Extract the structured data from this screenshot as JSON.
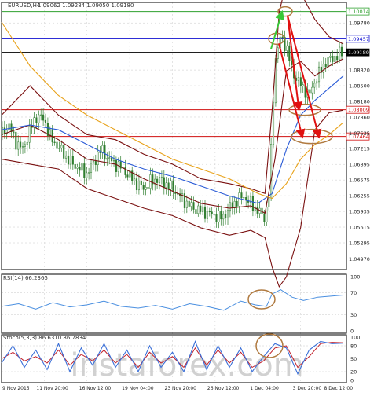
{
  "header": {
    "symbol": "EURUSD,H4",
    "ohlc": "1.09062 1.09284 1.09050 1.09180"
  },
  "indicators": {
    "rsi_label": "RSI(14) 66.2365",
    "stoch_label": "Stoch(5,3,3) 86.6310 86.7834"
  },
  "watermark": "instaforex.com",
  "colors": {
    "background": "#ffffff",
    "grid": "#c8c8c8",
    "candles": "#2e7d2e",
    "bollinger": "#7a1010",
    "ma_fast": "#7a1010",
    "ma_mid": "#2a5bd7",
    "ma_slow": "#e8a21a",
    "rsi_line": "#4a8fe0",
    "stoch_main": "#3a6fd8",
    "stoch_signal": "#c0202a",
    "level_blue": "#1010d0",
    "level_red": "#d01010",
    "level_green": "#2ea02e",
    "arrow_red": "#e01010",
    "arrow_green": "#37c837",
    "ellipse": "#b07a40"
  },
  "chart_data": [
    {
      "type": "line",
      "title": "EURUSD,H4",
      "y_ticks": [
        "1.09780",
        "1.09180",
        "1.08820",
        "1.08500",
        "1.08180",
        "1.07860",
        "1.07535",
        "1.07215",
        "1.06895",
        "1.06575",
        "1.06255",
        "1.05935",
        "1.05615",
        "1.05295",
        "1.04970"
      ],
      "x_ticks": [
        "9 Nov 2015",
        "11 Nov 20:00",
        "16 Nov 12:00",
        "19 Nov 04:00",
        "23 Nov 20:00",
        "26 Nov 12:00",
        "1 Dec 04:00",
        "3 Dec 20:00",
        "8 Dec 12:00"
      ],
      "ylim": [
        1.0475,
        1.102
      ],
      "horizontal_levels": [
        {
          "label": "1.10014",
          "value": 1.10014,
          "color": "#2ea02e"
        },
        {
          "label": "1.09457",
          "value": 1.09457,
          "color": "#1010d0"
        },
        {
          "label": "1.09180",
          "value": 1.0918,
          "color": "#000000"
        },
        {
          "label": "1.08009",
          "value": 1.08009,
          "color": "#d01010"
        },
        {
          "label": "1.07464",
          "value": 1.07464,
          "color": "#d01010"
        }
      ],
      "series": [
        {
          "kind": "close",
          "x": [
            0,
            5,
            10,
            15,
            20,
            25,
            30,
            35,
            40,
            45,
            50,
            55,
            60,
            65,
            70,
            75,
            80,
            85,
            90,
            95,
            100,
            105,
            110,
            115,
            120,
            125,
            130,
            135,
            140,
            145,
            150,
            155,
            160,
            165,
            170,
            175,
            180,
            185,
            188,
            192,
            196,
            200,
            204,
            208,
            212,
            216,
            220,
            224,
            228,
            232,
            236,
            240
          ],
          "values": [
            1.075,
            1.077,
            1.0735,
            1.072,
            1.076,
            1.079,
            1.078,
            1.074,
            1.0725,
            1.0705,
            1.069,
            1.068,
            1.067,
            1.0695,
            1.072,
            1.07,
            1.069,
            1.068,
            1.0665,
            1.065,
            1.064,
            1.0655,
            1.066,
            1.065,
            1.064,
            1.0625,
            1.061,
            1.06,
            1.0595,
            1.059,
            1.0585,
            1.058,
            1.06,
            1.0615,
            1.0625,
            1.061,
            1.0595,
            1.058,
            1.063,
            1.09,
            1.095,
            1.093,
            1.088,
            1.086,
            1.0845,
            1.083,
            1.086,
            1.088,
            1.09,
            1.0905,
            1.0912,
            1.0918
          ]
        },
        {
          "kind": "bollinger_upper",
          "x": [
            0,
            20,
            40,
            60,
            80,
            100,
            120,
            140,
            160,
            175,
            185,
            190,
            195,
            200,
            210,
            220,
            230,
            240
          ],
          "values": [
            1.079,
            1.085,
            1.079,
            1.075,
            1.074,
            1.071,
            1.069,
            1.066,
            1.065,
            1.064,
            1.063,
            1.08,
            1.1,
            1.106,
            1.104,
            1.0985,
            1.095,
            1.0935
          ]
        },
        {
          "kind": "bollinger_lower",
          "x": [
            0,
            20,
            40,
            60,
            80,
            100,
            120,
            140,
            160,
            175,
            185,
            190,
            195,
            200,
            210,
            220,
            230,
            240
          ],
          "values": [
            1.07,
            1.069,
            1.068,
            1.064,
            1.062,
            1.06,
            1.0585,
            1.056,
            1.0545,
            1.0555,
            1.054,
            1.048,
            1.044,
            1.046,
            1.056,
            1.076,
            1.0795,
            1.08
          ]
        },
        {
          "kind": "ma_fast",
          "x": [
            0,
            20,
            40,
            60,
            80,
            100,
            120,
            140,
            160,
            175,
            185,
            192,
            200,
            210,
            220,
            230,
            240
          ],
          "values": [
            1.075,
            1.077,
            1.074,
            1.07,
            1.069,
            1.066,
            1.0635,
            1.061,
            1.06,
            1.0605,
            1.059,
            1.07,
            1.088,
            1.09,
            1.087,
            1.089,
            1.0905
          ]
        },
        {
          "kind": "ma_mid",
          "x": [
            0,
            20,
            40,
            60,
            80,
            100,
            120,
            140,
            160,
            180,
            190,
            200,
            210,
            220,
            230,
            240
          ],
          "values": [
            1.076,
            1.077,
            1.076,
            1.073,
            1.07,
            1.068,
            1.0665,
            1.0645,
            1.0625,
            1.061,
            1.063,
            1.072,
            1.079,
            1.082,
            1.0845,
            1.087
          ]
        },
        {
          "kind": "ma_slow",
          "x": [
            0,
            20,
            40,
            60,
            80,
            100,
            120,
            140,
            160,
            180,
            190,
            200,
            210,
            220,
            230,
            240
          ],
          "values": [
            1.098,
            1.089,
            1.083,
            1.079,
            1.076,
            1.073,
            1.07,
            1.068,
            1.066,
            1.063,
            1.062,
            1.065,
            1.07,
            1.073,
            1.075,
            1.0775
          ]
        }
      ]
    },
    {
      "type": "line",
      "title": "RSI(14) 66.2365",
      "y_ticks": [
        "100",
        "70",
        "30",
        "0"
      ],
      "ylim": [
        0,
        100
      ],
      "series": [
        {
          "x": [
            0,
            12,
            24,
            36,
            48,
            60,
            72,
            84,
            96,
            108,
            120,
            132,
            144,
            156,
            168,
            178,
            186,
            190,
            196,
            204,
            212,
            222,
            232,
            240
          ],
          "values": [
            45,
            50,
            40,
            52,
            44,
            48,
            55,
            45,
            42,
            47,
            40,
            50,
            45,
            38,
            55,
            48,
            45,
            68,
            76,
            62,
            56,
            62,
            64,
            66
          ]
        }
      ]
    },
    {
      "type": "line",
      "title": "Stoch(5,3,3) 86.6310 86.7834",
      "y_ticks": [
        "100",
        "80",
        "50",
        "20",
        "0"
      ],
      "ylim": [
        0,
        100
      ],
      "series": [
        {
          "name": "main",
          "x": [
            0,
            8,
            16,
            24,
            32,
            40,
            48,
            56,
            64,
            72,
            80,
            88,
            96,
            104,
            112,
            120,
            128,
            136,
            144,
            152,
            160,
            168,
            176,
            184,
            192,
            200,
            208,
            216,
            224,
            232,
            240
          ],
          "values": [
            40,
            80,
            30,
            70,
            25,
            85,
            20,
            75,
            35,
            85,
            30,
            70,
            20,
            80,
            30,
            65,
            20,
            90,
            25,
            80,
            30,
            75,
            20,
            55,
            85,
            75,
            15,
            70,
            90,
            85,
            86
          ]
        },
        {
          "name": "signal",
          "x": [
            0,
            8,
            16,
            24,
            32,
            40,
            48,
            56,
            64,
            72,
            80,
            88,
            96,
            104,
            112,
            120,
            128,
            136,
            144,
            152,
            160,
            168,
            176,
            184,
            192,
            200,
            208,
            216,
            224,
            232,
            240
          ],
          "values": [
            50,
            65,
            45,
            55,
            40,
            70,
            35,
            60,
            45,
            70,
            40,
            60,
            30,
            65,
            40,
            55,
            30,
            75,
            35,
            70,
            40,
            65,
            30,
            45,
            75,
            80,
            30,
            55,
            85,
            88,
            87
          ]
        }
      ]
    }
  ]
}
